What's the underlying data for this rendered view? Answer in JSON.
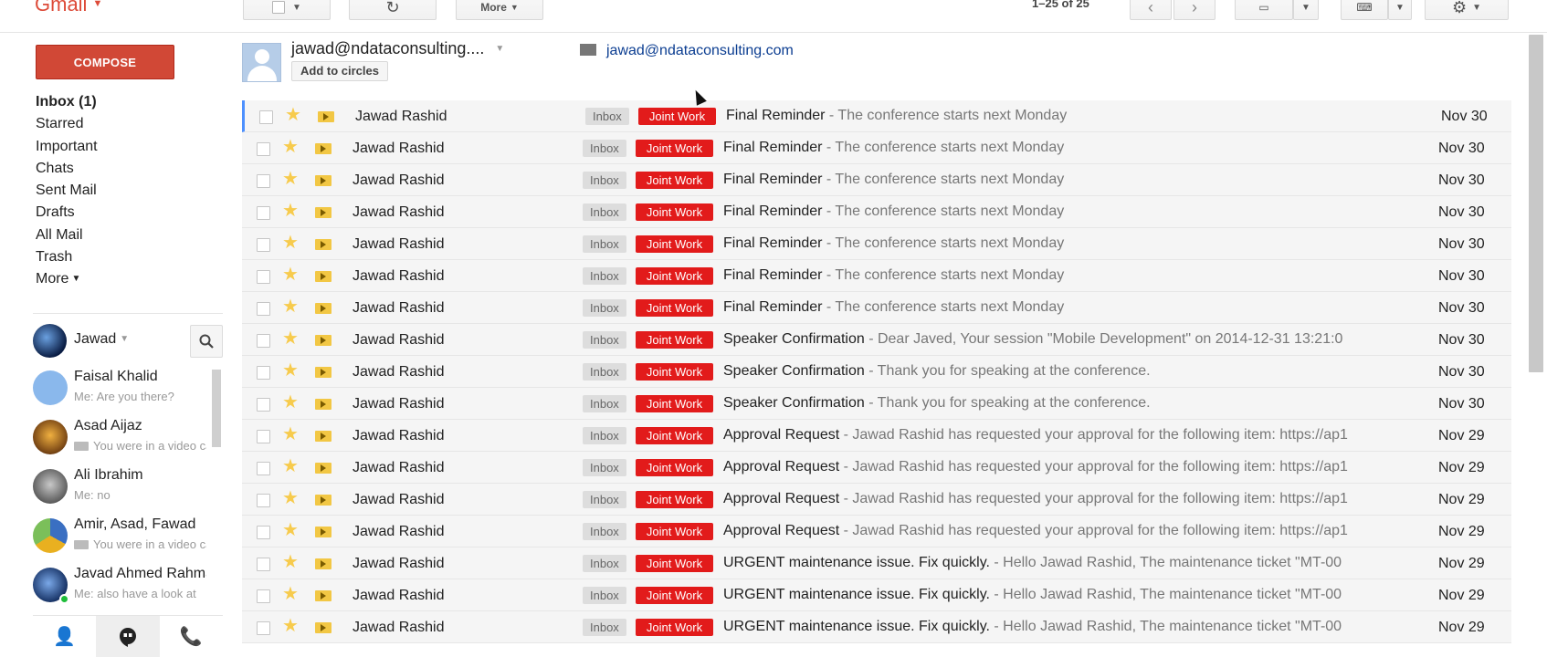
{
  "app": {
    "logo": "Gmail",
    "brand_color": "#dd4b39"
  },
  "toolbar": {
    "more_label": "More",
    "pagination": "1–25 of 25"
  },
  "sidebar": {
    "compose_label": "COMPOSE",
    "items": [
      {
        "label": "Inbox (1)",
        "active": true
      },
      {
        "label": "Starred"
      },
      {
        "label": "Important"
      },
      {
        "label": "Chats"
      },
      {
        "label": "Sent Mail"
      },
      {
        "label": "Drafts"
      },
      {
        "label": "All Mail"
      },
      {
        "label": "Trash"
      },
      {
        "label": "More"
      }
    ]
  },
  "hangouts": {
    "me": "Jawad",
    "contacts": [
      {
        "name": "Faisal Khalid",
        "status": "Me: Are you there?"
      },
      {
        "name": "Asad Aijaz",
        "status": "You were in a video call"
      },
      {
        "name": "Ali Ibrahim",
        "status": "Me: no"
      },
      {
        "name": "Amir, Asad, Fawad",
        "status": "You were in a video call"
      },
      {
        "name": "Javad Ahmed Rahman",
        "status": "Me: also have a look at"
      }
    ]
  },
  "sender_card": {
    "display_email": "jawad@ndataconsulting....",
    "add_to_circles": "Add to circles",
    "email": "jawad@ndataconsulting.com"
  },
  "mail": {
    "rows": [
      {
        "sender": "Jawad Rashid",
        "inbox": "Inbox",
        "label": "Joint Work",
        "subject": "Final Reminder",
        "snippet": " - The conference starts next Monday",
        "date": "Nov 30"
      },
      {
        "sender": "Jawad Rashid",
        "inbox": "Inbox",
        "label": "Joint Work",
        "subject": "Final Reminder",
        "snippet": " - The conference starts next Monday",
        "date": "Nov 30"
      },
      {
        "sender": "Jawad Rashid",
        "inbox": "Inbox",
        "label": "Joint Work",
        "subject": "Final Reminder",
        "snippet": " - The conference starts next Monday",
        "date": "Nov 30"
      },
      {
        "sender": "Jawad Rashid",
        "inbox": "Inbox",
        "label": "Joint Work",
        "subject": "Final Reminder",
        "snippet": " - The conference starts next Monday",
        "date": "Nov 30"
      },
      {
        "sender": "Jawad Rashid",
        "inbox": "Inbox",
        "label": "Joint Work",
        "subject": "Final Reminder",
        "snippet": " - The conference starts next Monday",
        "date": "Nov 30"
      },
      {
        "sender": "Jawad Rashid",
        "inbox": "Inbox",
        "label": "Joint Work",
        "subject": "Final Reminder",
        "snippet": " - The conference starts next Monday",
        "date": "Nov 30"
      },
      {
        "sender": "Jawad Rashid",
        "inbox": "Inbox",
        "label": "Joint Work",
        "subject": "Final Reminder",
        "snippet": " - The conference starts next Monday",
        "date": "Nov 30"
      },
      {
        "sender": "Jawad Rashid",
        "inbox": "Inbox",
        "label": "Joint Work",
        "subject": "Speaker Confirmation",
        "snippet": " - Dear Javed, Your session \"Mobile Development\" on 2014-12-31 13:21:0",
        "date": "Nov 30"
      },
      {
        "sender": "Jawad Rashid",
        "inbox": "Inbox",
        "label": "Joint Work",
        "subject": "Speaker Confirmation",
        "snippet": " - Thank you for speaking at the conference.",
        "date": "Nov 30"
      },
      {
        "sender": "Jawad Rashid",
        "inbox": "Inbox",
        "label": "Joint Work",
        "subject": "Speaker Confirmation",
        "snippet": " - Thank you for speaking at the conference.",
        "date": "Nov 30"
      },
      {
        "sender": "Jawad Rashid",
        "inbox": "Inbox",
        "label": "Joint Work",
        "subject": "Approval Request",
        "snippet": " - Jawad Rashid has requested your approval for the following item: https://ap1",
        "date": "Nov 29"
      },
      {
        "sender": "Jawad Rashid",
        "inbox": "Inbox",
        "label": "Joint Work",
        "subject": "Approval Request",
        "snippet": " - Jawad Rashid has requested your approval for the following item: https://ap1",
        "date": "Nov 29"
      },
      {
        "sender": "Jawad Rashid",
        "inbox": "Inbox",
        "label": "Joint Work",
        "subject": "Approval Request",
        "snippet": " - Jawad Rashid has requested your approval for the following item: https://ap1",
        "date": "Nov 29"
      },
      {
        "sender": "Jawad Rashid",
        "inbox": "Inbox",
        "label": "Joint Work",
        "subject": "Approval Request",
        "snippet": " - Jawad Rashid has requested your approval for the following item: https://ap1",
        "date": "Nov 29"
      },
      {
        "sender": "Jawad Rashid",
        "inbox": "Inbox",
        "label": "Joint Work",
        "subject": "URGENT maintenance issue. Fix quickly.",
        "snippet": " - Hello Jawad Rashid, The maintenance ticket \"MT-00",
        "date": "Nov 29"
      },
      {
        "sender": "Jawad Rashid",
        "inbox": "Inbox",
        "label": "Joint Work",
        "subject": "URGENT maintenance issue. Fix quickly.",
        "snippet": " - Hello Jawad Rashid, The maintenance ticket \"MT-00",
        "date": "Nov 29"
      },
      {
        "sender": "Jawad Rashid",
        "inbox": "Inbox",
        "label": "Joint Work",
        "subject": "URGENT maintenance issue. Fix quickly.",
        "snippet": " - Hello Jawad Rashid, The maintenance ticket \"MT-00",
        "date": "Nov 29"
      }
    ]
  },
  "colors": {
    "compose_bg": "#d14836",
    "label_red": "#e21b1b",
    "star": "#f7cb4d",
    "link": "#0b3d91"
  }
}
